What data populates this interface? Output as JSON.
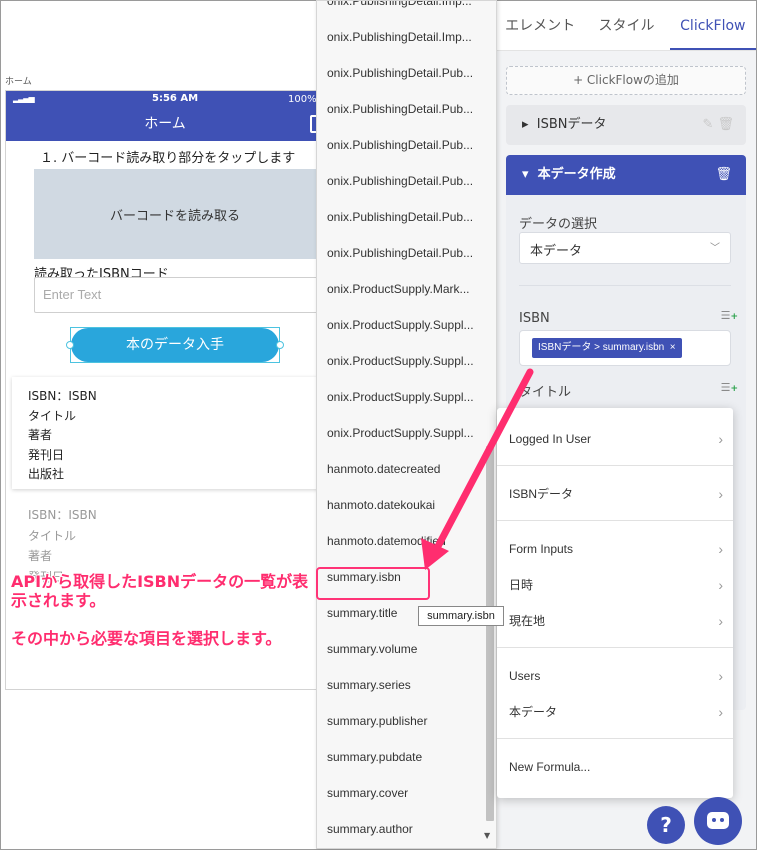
{
  "preview": {
    "screen_label": "ホーム",
    "status": {
      "time": "5:56 AM",
      "battery": "100%"
    },
    "header_title": "ホーム",
    "step_text": "１. バーコード読み取り部分をタップします",
    "scan_label": "バーコードを読み取る",
    "read_label": "読み取ったISBNコード",
    "input_placeholder": "Enter Text",
    "get_button": "本のデータ入手",
    "card1": [
      "ISBN：ISBN",
      "タイトル",
      "著者",
      "発刊日",
      "出版社"
    ],
    "card2": [
      "ISBN：ISBN",
      "タイトル",
      "著者",
      "発刊日"
    ]
  },
  "callout": {
    "line1": "APIから取得したISBNデータの一覧が表示されます。",
    "line2": "その中から必要な項目を選択します。"
  },
  "dropdown": {
    "items": [
      "onix.PublishingDetail.Imp...",
      "onix.PublishingDetail.Imp...",
      "onix.PublishingDetail.Pub...",
      "onix.PublishingDetail.Pub...",
      "onix.PublishingDetail.Pub...",
      "onix.PublishingDetail.Pub...",
      "onix.PublishingDetail.Pub...",
      "onix.PublishingDetail.Pub...",
      "onix.ProductSupply.Mark...",
      "onix.ProductSupply.Suppl...",
      "onix.ProductSupply.Suppl...",
      "onix.ProductSupply.Suppl...",
      "onix.ProductSupply.Suppl...",
      "hanmoto.datecreated",
      "hanmoto.datekoukai",
      "hanmoto.datemodified",
      "summary.isbn",
      "summary.title",
      "summary.volume",
      "summary.series",
      "summary.publisher",
      "summary.pubdate",
      "summary.cover",
      "summary.author"
    ],
    "tooltip": "summary.isbn"
  },
  "panel": {
    "tabs": [
      "エレメント",
      "スタイル",
      "ClickFlow"
    ],
    "add_clickflow": "+ ClickFlowの追加",
    "acc1_title": "ISBNデータ",
    "acc2_title": "本データ作成",
    "select_label": "データの選択",
    "select_value": "本データ",
    "isbn_label": "ISBN",
    "isbn_chip": "ISBNデータ > summary.isbn",
    "title_label": "タイトル"
  },
  "menu": {
    "items": [
      "Logged In User",
      "ISBNデータ",
      "Form Inputs",
      "日時",
      "現在地",
      "Users",
      "本データ",
      "New Formula..."
    ]
  },
  "fab": {
    "help": "?"
  },
  "colors": {
    "primary": "#3f51b5",
    "accent": "#ff2d6f",
    "button": "#29a6dc"
  }
}
